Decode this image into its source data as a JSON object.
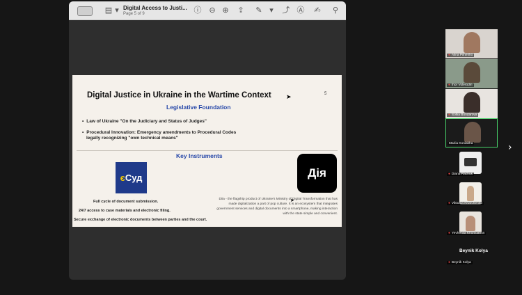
{
  "viewer": {
    "title": "Digital Access to Justi...",
    "page_indicator": "Page 5 of 9"
  },
  "slide": {
    "title": "Digital Justice in Ukraine in the Wartime Context",
    "number": "5",
    "legislative_heading": "Legislative Foundation",
    "bullets": [
      "Law of Ukraine \"On the Judiciary and Status of Judges\"",
      "Procedural Innovation: Emergency amendments to Procedural Codes",
      "legally recognizing \"own technical means\""
    ],
    "instruments_heading": "Key Instruments",
    "esud_logo_prefix": "є",
    "esud_logo_rest": "Суд",
    "esud_features": [
      "Full cycle of document submission.",
      "24/7 access to case materials and electronic filing.",
      "Secure exchange of electronic documents between parties and the court."
    ],
    "diia_logo": "Дія",
    "diia_description": "Diia - the flagship product of Ukraine's Ministry of Digital Transformation that has made digitalization a part of pop culture. It is an ecosystem that integrates government services and digital documents into a smartphone, making interaction with the state simple and convenient."
  },
  "participants": [
    {
      "name": "Alina Pilnenko"
    },
    {
      "name": "Ihor Volerodin"
    },
    {
      "name": "Sofiia Bondarova"
    },
    {
      "name": "Mariia Koniakha"
    },
    {
      "name": "Diana Rachuk"
    },
    {
      "name": "Viktoriia Kharchenko"
    },
    {
      "name": "Yevheniia Khonioahun"
    },
    {
      "name": "Beynik Kolya"
    }
  ],
  "name_only_tile": "Beynik Kolya",
  "colors": {
    "accent_heading": "#2647a8",
    "esud_blue": "#1f3a8a",
    "active_speaker": "#4ad36b"
  }
}
